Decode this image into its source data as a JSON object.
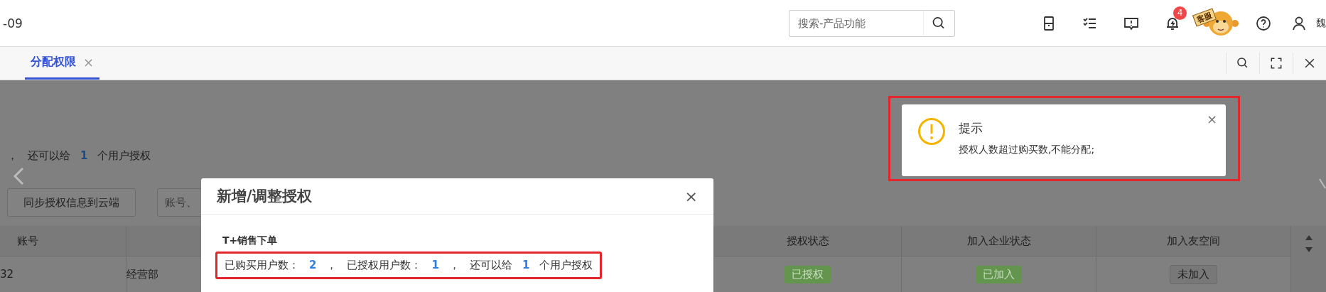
{
  "header": {
    "date_fragment": "-09",
    "search": {
      "placeholder": "搜索-产品功能"
    },
    "notification_count": "4",
    "support_label": "客服",
    "user_name": "魏"
  },
  "tabs": [
    {
      "label": "分配权限",
      "selected": true,
      "close": "×"
    }
  ],
  "page": {
    "summary": {
      "prefix": "，",
      "text": "还可以给",
      "count": "1",
      "suffix": "个用户授权"
    },
    "sync_button": "同步授权信息到云端",
    "search": {
      "placeholder": "账号、"
    },
    "table": {
      "columns": [
        "账号",
        "授权状态",
        "加入企业状态",
        "加入友空间"
      ],
      "rows": [
        {
          "account": "32",
          "department": "经营部",
          "tags": [
            {
              "label": "已授权",
              "active": true
            },
            {
              "label": "已加入",
              "active": true
            },
            {
              "label": "未加入",
              "active": false
            }
          ]
        }
      ]
    }
  },
  "dialog": {
    "title": "新增/调整授权",
    "close": "×",
    "product": "T+销售下单",
    "highlighted": true,
    "quota_line": [
      {
        "kind": "label",
        "text": "已购买用户数："
      },
      {
        "kind": "count",
        "text": "2"
      },
      {
        "kind": "label",
        "text": "，"
      },
      {
        "kind": "label",
        "text": "已授权用户数："
      },
      {
        "kind": "count",
        "text": "1"
      },
      {
        "kind": "label",
        "text": "，"
      },
      {
        "kind": "label",
        "text": "还可以给"
      },
      {
        "kind": "count",
        "text": "1"
      },
      {
        "kind": "label",
        "text": "个用户授权"
      }
    ]
  },
  "notification": {
    "title": "提示",
    "close": "×",
    "message": "授权人数超过购买数,不能分配;",
    "highlighted": true
  }
}
